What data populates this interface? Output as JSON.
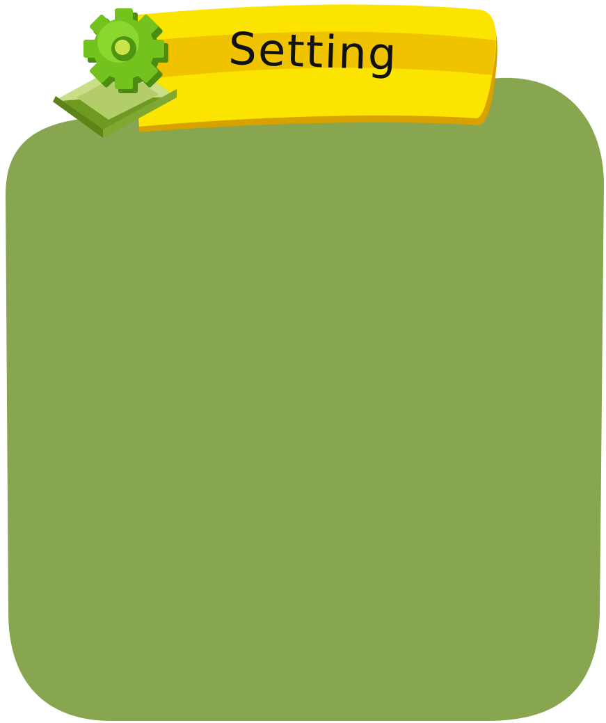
{
  "panel": {
    "title": "Setting",
    "background_color": "#88a54f",
    "banner_color": "#fbe400",
    "banner_stripe_color": "#efc300",
    "banner_shadow_color": "#d7a200",
    "title_color": "#111111"
  },
  "icons": {
    "settings": "gear-icon"
  }
}
